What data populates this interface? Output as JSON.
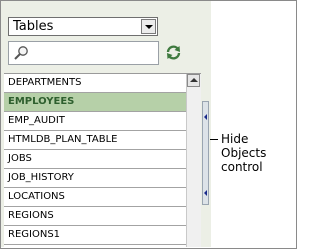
{
  "object_type_select": {
    "selected": "Tables"
  },
  "search": {
    "value": ""
  },
  "object_list": {
    "items": [
      {
        "label": "DEPARTMENTS",
        "selected": false
      },
      {
        "label": "EMPLOYEES",
        "selected": true
      },
      {
        "label": "EMP_AUDIT",
        "selected": false
      },
      {
        "label": "HTMLDB_PLAN_TABLE",
        "selected": false
      },
      {
        "label": "JOBS",
        "selected": false
      },
      {
        "label": "JOB_HISTORY",
        "selected": false
      },
      {
        "label": "LOCATIONS",
        "selected": false
      },
      {
        "label": "REGIONS",
        "selected": false
      },
      {
        "label": "REGIONS1",
        "selected": false
      }
    ]
  },
  "callout": {
    "line1": "Hide Objects",
    "line2": "control"
  },
  "icons": {
    "search": "magnifier-icon",
    "refresh": "refresh-icon",
    "dropdown": "chevron-down-icon",
    "scroll_up": "scroll-up-arrow-icon",
    "hide_control": "hide-objects-arrow-icon"
  },
  "colors": {
    "panel_bg": "#ecefe6",
    "selected_row_bg": "#b6d0a8",
    "selected_row_text": "#2e5f2e",
    "refresh_icon": "#3f7a3f"
  }
}
